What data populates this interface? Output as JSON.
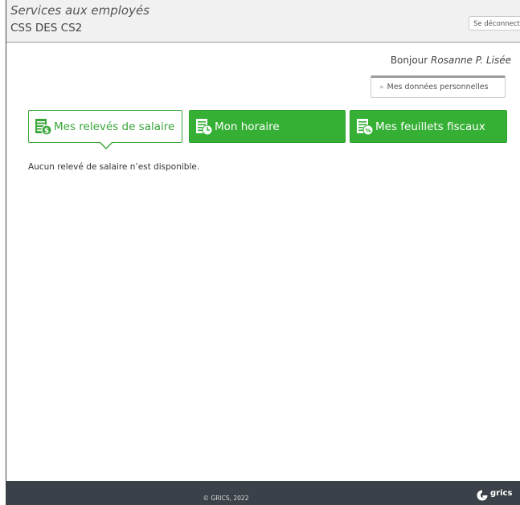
{
  "header": {
    "app_title": "Services aux employés",
    "org_name": "CSS DES CS2",
    "logout_label": "Se déconnecter"
  },
  "greeting": {
    "prefix": "Bonjour",
    "user_name": "Rosanne P. Lisée"
  },
  "personal_data": {
    "label": "Mes données personnelles"
  },
  "tabs": [
    {
      "label": "Mes relevés de salaire",
      "icon": "payslip-dollar-icon",
      "active": true
    },
    {
      "label": "Mon horaire",
      "icon": "schedule-clock-icon",
      "active": false
    },
    {
      "label": "Mes feuillets fiscaux",
      "icon": "tax-slip-icon",
      "active": false
    }
  ],
  "content": {
    "message": "Aucun relevé de salaire n’est disponible."
  },
  "footer": {
    "copyright": "© GRICS, 2022",
    "brand": "grics"
  },
  "colors": {
    "accent_green": "#35b035",
    "footer_bg": "#3b4148",
    "header_bg": "#f1f1f1"
  }
}
